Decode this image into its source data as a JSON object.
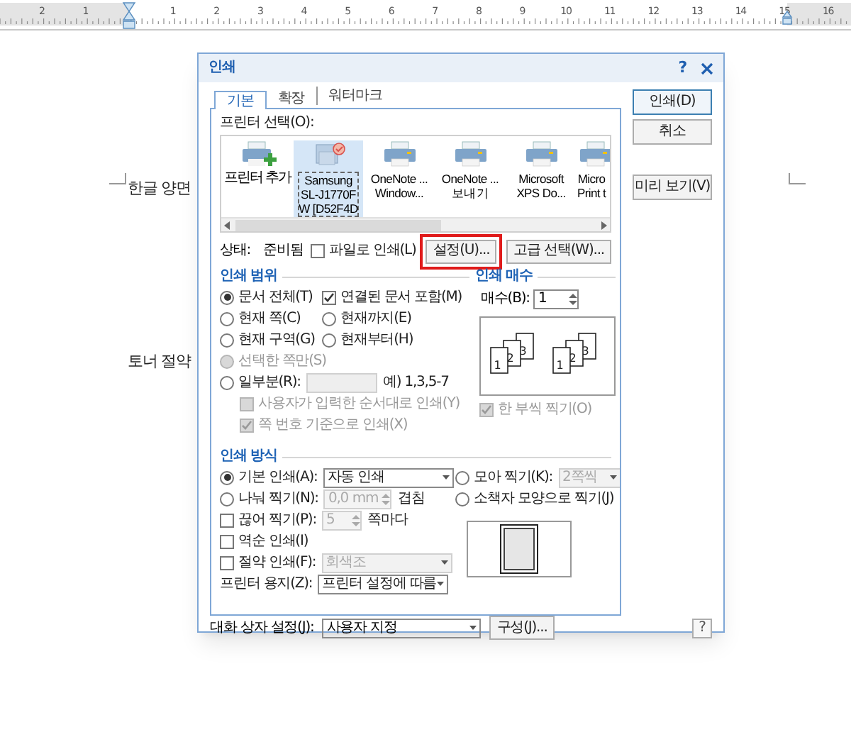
{
  "document": {
    "ruler_labels": [
      "2",
      "1",
      "1",
      "2",
      "3",
      "4",
      "5",
      "6",
      "7",
      "8",
      "9",
      "10",
      "11",
      "12",
      "13",
      "14",
      "15",
      "16"
    ],
    "lines": [
      "한글 양면",
      "토너 절약"
    ]
  },
  "dialog": {
    "title": "인쇄",
    "help": "?",
    "tabs": [
      {
        "label": "기본",
        "selected": true
      },
      {
        "label": "확장",
        "selected": false
      },
      {
        "label": "워터마크",
        "selected": false
      }
    ],
    "printer_label": "프린터 선택(O):",
    "printers": [
      {
        "kind": "add",
        "lines": [
          "프린터 추가"
        ],
        "selected": false
      },
      {
        "kind": "shared",
        "lines": [
          "Samsung",
          "SL-J1770F",
          "W [D52F4D"
        ],
        "selected": true
      },
      {
        "kind": "printer",
        "lines": [
          "OneNote ...",
          "Window..."
        ],
        "selected": false
      },
      {
        "kind": "printer",
        "lines": [
          "OneNote ...",
          "보내기"
        ],
        "selected": false
      },
      {
        "kind": "printer",
        "lines": [
          "Microsoft",
          "XPS Do..."
        ],
        "selected": false
      },
      {
        "kind": "printer",
        "lines": [
          "Micro",
          "Print t"
        ],
        "selected": false
      }
    ],
    "status": {
      "label": "상태:",
      "value": "준비됨"
    },
    "print_to_file": {
      "label": "파일로 인쇄(L)",
      "checked": false
    },
    "settings_button": {
      "label": "설정(U)...",
      "highlighted": true
    },
    "advanced_button": "고급 선택(W)...",
    "range": {
      "title": "인쇄 범위",
      "rows": [
        {
          "items": [
            {
              "kind": "radio",
              "label": "문서 전체(T)",
              "selected": true,
              "disabled": false
            },
            {
              "kind": "checkbox",
              "label": "연결된 문서 포함(M)",
              "checked": true,
              "disabled": false
            }
          ]
        },
        {
          "items": [
            {
              "kind": "radio",
              "label": "현재 쪽(C)",
              "selected": false,
              "disabled": false
            },
            {
              "kind": "radio",
              "label": "현재까지(E)",
              "selected": false,
              "disabled": false
            }
          ]
        },
        {
          "items": [
            {
              "kind": "radio",
              "label": "현재 구역(G)",
              "selected": false,
              "disabled": false
            },
            {
              "kind": "radio",
              "label": "현재부터(H)",
              "selected": false,
              "disabled": false
            }
          ]
        },
        {
          "items": [
            {
              "kind": "radio",
              "label": "선택한 쪽만(S)",
              "selected": false,
              "disabled": true
            }
          ]
        },
        {
          "items": [
            {
              "kind": "radio",
              "label": "일부분(R):",
              "selected": false,
              "disabled": false
            },
            {
              "kind": "field",
              "disabled": true
            },
            {
              "kind": "text",
              "label": "예) 1,3,5-7",
              "disabled": false
            }
          ]
        },
        {
          "items": [
            {
              "kind": "checkbox",
              "label": "사용자가 입력한 순서대로 인쇄(Y)",
              "checked": false,
              "disabled": true
            }
          ]
        },
        {
          "items": [
            {
              "kind": "checkbox",
              "label": "쪽 번호 기준으로 인쇄(X)",
              "checked": true,
              "disabled": true
            }
          ]
        }
      ]
    },
    "copies": {
      "title": "인쇄 매수",
      "label": "매수(B):",
      "value": "1",
      "page_labels": [
        "1",
        "2",
        "3",
        "1",
        "2",
        "3"
      ],
      "collate": {
        "label": "한 부씩 찍기(O)",
        "checked": true,
        "disabled": true
      }
    },
    "method": {
      "title": "인쇄 방식",
      "rows": [
        {
          "items": [
            {
              "kind": "radio",
              "label": "기본 인쇄(A):",
              "selected": true,
              "disabled": false
            },
            {
              "kind": "select",
              "value": "자동 인쇄",
              "disabled": false
            }
          ]
        },
        {
          "items": [
            {
              "kind": "radio",
              "label": "나눠 찍기(N):",
              "selected": false,
              "disabled": false
            },
            {
              "kind": "spinner",
              "value": "0,0",
              "unit": "mm",
              "disabled": true
            },
            {
              "kind": "text",
              "label": "겹침",
              "disabled": false
            }
          ]
        },
        {
          "items": [
            {
              "kind": "checkbox",
              "label": "끊어 찍기(P):",
              "checked": false,
              "disabled": false
            },
            {
              "kind": "spinner",
              "value": "5",
              "disabled": true
            },
            {
              "kind": "text",
              "label": "쪽마다",
              "disabled": false
            }
          ]
        },
        {
          "items": [
            {
              "kind": "checkbox",
              "label": "역순 인쇄(I)",
              "checked": false,
              "disabled": false
            }
          ]
        },
        {
          "items": [
            {
              "kind": "checkbox",
              "label": "절약 인쇄(F):",
              "checked": false,
              "disabled": false
            },
            {
              "kind": "select",
              "value": "회색조",
              "disabled": true
            }
          ]
        },
        {
          "items": [
            {
              "kind": "text",
              "label": "프린터 용지(Z):",
              "disabled": false
            },
            {
              "kind": "select",
              "value": "프린터 설정에 따름",
              "disabled": false
            }
          ]
        }
      ],
      "side_rows": [
        {
          "items": [
            {
              "kind": "radio",
              "label": "모아 찍기(K):",
              "selected": false,
              "disabled": false
            },
            {
              "kind": "select",
              "value": "2쪽씩",
              "disabled": true
            }
          ]
        },
        {
          "items": [
            {
              "kind": "radio",
              "label": "소책자 모양으로 찍기(J)",
              "selected": false,
              "disabled": false
            }
          ]
        }
      ]
    },
    "footer": {
      "label": "대화 상자 설정(J):",
      "value": "사용자 지정",
      "button": "구성(J)...",
      "help": "?"
    },
    "buttons": [
      {
        "label": "인쇄(D)",
        "default": true
      },
      {
        "label": "취소",
        "default": false
      },
      {
        "label": "미리 보기(V)",
        "default": false
      }
    ]
  }
}
